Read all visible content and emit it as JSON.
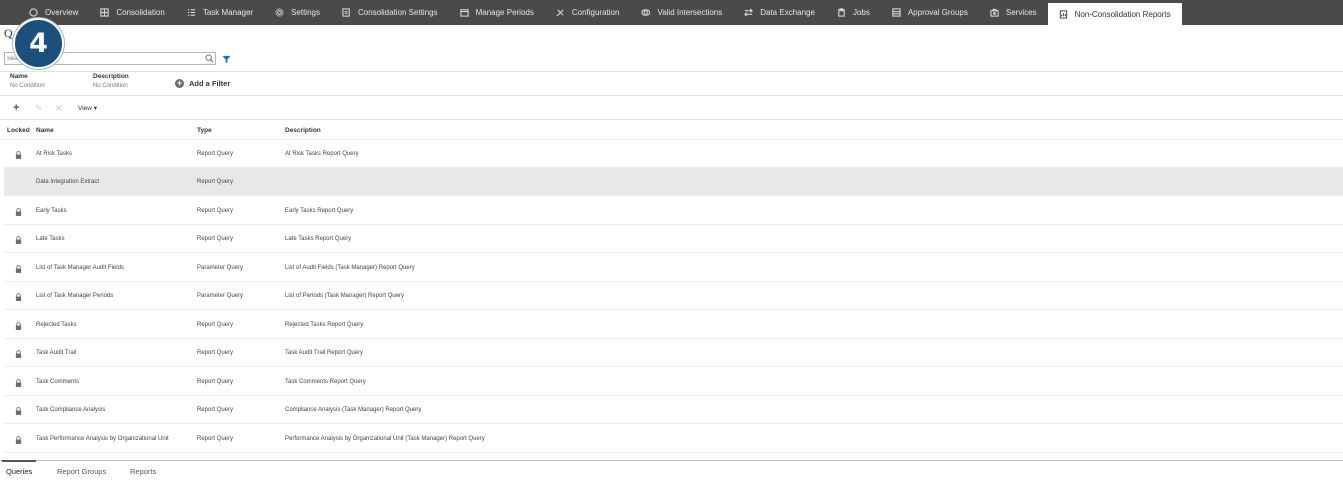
{
  "nav": {
    "items": [
      {
        "label": "Overview",
        "icon": "overview-icon"
      },
      {
        "label": "Consolidation",
        "icon": "grid-icon"
      },
      {
        "label": "Task Manager",
        "icon": "task-list-icon"
      },
      {
        "label": "Settings",
        "icon": "gear-icon"
      },
      {
        "label": "Consolidation Settings",
        "icon": "settings-doc-icon"
      },
      {
        "label": "Manage Periods",
        "icon": "calendar-icon"
      },
      {
        "label": "Configuration",
        "icon": "tools-icon"
      },
      {
        "label": "Valid Intersections",
        "icon": "intersection-icon"
      },
      {
        "label": "Data Exchange",
        "icon": "exchange-arrows-icon"
      },
      {
        "label": "Jobs",
        "icon": "clipboard-icon"
      },
      {
        "label": "Approval Groups",
        "icon": "approval-grid-icon"
      },
      {
        "label": "Services",
        "icon": "toolbox-icon"
      },
      {
        "label": "Non-Consolidation Reports",
        "icon": "report-icon"
      }
    ],
    "active_index": 12
  },
  "badge": {
    "number": "4"
  },
  "page": {
    "title_visible": "Q"
  },
  "search": {
    "placeholder": "Search"
  },
  "conditions": {
    "name_label": "Name",
    "name_value": "No Condition",
    "description_label": "Description",
    "description_value": "No Condition",
    "add_filter_label": "Add a Filter"
  },
  "toolbar": {
    "add_symbol": "+",
    "edit_symbol": "✎",
    "delete_symbol": "✕",
    "view_label": "View ▾"
  },
  "table": {
    "headers": {
      "locked": "Locked",
      "name": "Name",
      "type": "Type",
      "description": "Description"
    },
    "rows": [
      {
        "locked": true,
        "name": "At Risk Tasks",
        "type": "Report Query",
        "description": "At Risk Tasks Report Query"
      },
      {
        "locked": false,
        "name": "Data Integration Extract",
        "type": "Report Query",
        "description": ""
      },
      {
        "locked": true,
        "name": "Early Tasks",
        "type": "Report Query",
        "description": "Early Tasks Report Query"
      },
      {
        "locked": true,
        "name": "Late Tasks",
        "type": "Report Query",
        "description": "Late Tasks Report Query"
      },
      {
        "locked": true,
        "name": "List of Task Manager Audit Fields",
        "type": "Parameter Query",
        "description": "List of Audit Fields (Task Manager) Report Query"
      },
      {
        "locked": true,
        "name": "List of Task Manager Periods",
        "type": "Parameter Query",
        "description": "List of Periods (Task Manager) Report Query"
      },
      {
        "locked": true,
        "name": "Rejected Tasks",
        "type": "Report Query",
        "description": "Rejected Tasks Report Query"
      },
      {
        "locked": true,
        "name": "Task Audit Trail",
        "type": "Report Query",
        "description": "Task Audit Trail Report Query"
      },
      {
        "locked": true,
        "name": "Task Comments",
        "type": "Report Query",
        "description": "Task Comments Report Query"
      },
      {
        "locked": true,
        "name": "Task Compliance Analysis",
        "type": "Report Query",
        "description": "Compliance Analysis (Task Manager) Report Query"
      },
      {
        "locked": true,
        "name": "Task Performance Analysis by Organizational Unit",
        "type": "Report Query",
        "description": "Performance Analysis by Organizational Unit (Task Manager) Report Query"
      }
    ],
    "selected_index": 1
  },
  "bottom_tabs": {
    "items": [
      "Queries",
      "Report Groups",
      "Reports"
    ],
    "active_index": 0
  },
  "colors": {
    "nav_bg": "#4a4a4a",
    "badge_bg": "#1b4f7c",
    "filter_accent": "#1f6fb5",
    "selected_row": "#e8e8e8"
  }
}
